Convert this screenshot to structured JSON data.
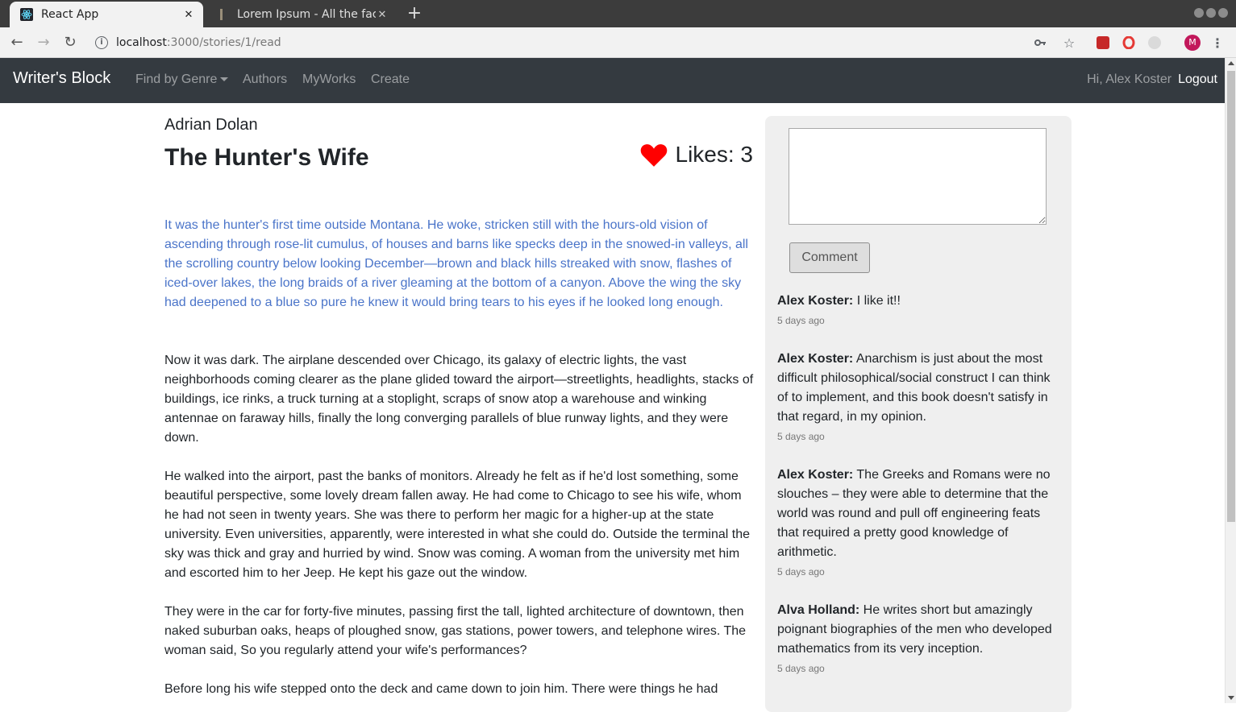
{
  "browser": {
    "tabs": [
      {
        "title": "React App",
        "active": true
      },
      {
        "title": "Lorem Ipsum - All the facts",
        "active": false
      }
    ],
    "url_host": "localhost",
    "url_path": ":3000/stories/1/read",
    "profile_initial": "M"
  },
  "navbar": {
    "brand": "Writer's Block",
    "links": [
      "Find by Genre",
      "Authors",
      "MyWorks",
      "Create"
    ],
    "greeting": "Hi, Alex Koster",
    "logout": "Logout"
  },
  "story": {
    "author": "Adrian Dolan",
    "title": "The Hunter's Wife",
    "likes_label": "Likes: 3",
    "heart_color": "#ff0000",
    "highlight_color": "#4a74c9",
    "paragraphs": [
      "It was the hunter's first time outside Montana. He woke, stricken still with the hours-old vision of ascending through rose-lit cumulus, of houses and barns like specks deep in the snowed-in valleys, all the scrolling country below looking December—brown and black hills streaked with snow, flashes of iced-over lakes, the long braids of a river gleaming at the bottom of a canyon. Above the wing the sky had deepened to a blue so pure he knew it would bring tears to his eyes if he looked long enough.",
      "Now it was dark. The airplane descended over Chicago, its galaxy of electric lights, the vast neighborhoods coming clearer as the plane glided toward the airport—streetlights, headlights, stacks of buildings, ice rinks, a truck turning at a stoplight, scraps of snow atop a warehouse and winking antennae on faraway hills, finally the long converging parallels of blue runway lights, and they were down.",
      "He walked into the airport, past the banks of monitors. Already he felt as if he'd lost something, some beautiful perspective, some lovely dream fallen away. He had come to Chicago to see his wife, whom he had not seen in twenty years. She was there to perform her magic for a higher-up at the state university. Even universities, apparently, were interested in what she could do. Outside the terminal the sky was thick and gray and hurried by wind. Snow was coming. A woman from the university met him and escorted him to her Jeep. He kept his gaze out the window.",
      "They were in the car for forty-five minutes, passing first the tall, lighted architecture of downtown, then naked suburban oaks, heaps of ploughed snow, gas stations, power towers, and telephone wires. The woman said, So you regularly attend your wife's performances?",
      "Before long his wife stepped onto the deck and came down to join him. There were things he had"
    ]
  },
  "comments_panel": {
    "button_label": "Comment",
    "comments": [
      {
        "author": "Alex Koster:",
        "text": " I like it!!",
        "time": "5 days ago"
      },
      {
        "author": "Alex Koster:",
        "text": " Anarchism is just about the most difficult philosophical/social construct I can think of to implement, and this book doesn't satisfy in that regard, in my opinion.",
        "time": "5 days ago"
      },
      {
        "author": "Alex Koster:",
        "text": " The Greeks and Romans were no slouches – they were able to determine that the world was round and pull off engineering feats that required a pretty good knowledge of arithmetic.",
        "time": "5 days ago"
      },
      {
        "author": "Alva Holland:",
        "text": " He writes short but amazingly poignant biographies of the men who developed mathematics from its very inception.",
        "time": "5 days ago"
      }
    ]
  }
}
